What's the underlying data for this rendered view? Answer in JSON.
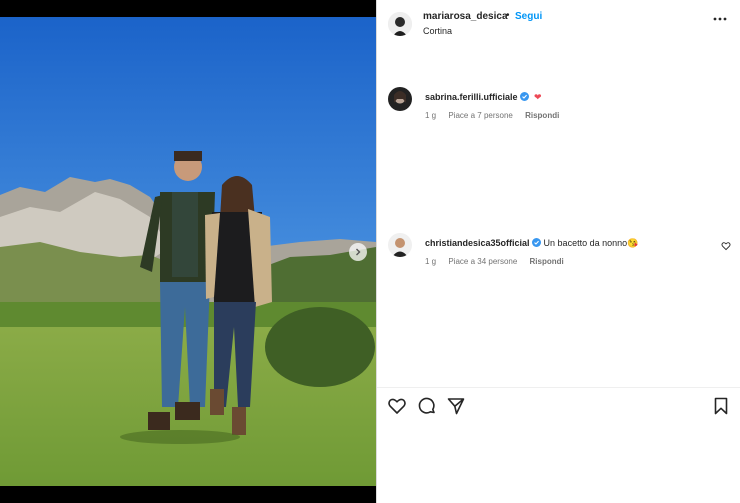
{
  "header": {
    "username": "mariarosa_desica",
    "separator": "•",
    "follow_label": "Segui",
    "location": "Cortina",
    "avatar_icon": "profile-avatar",
    "more_icon": "more-options-icon"
  },
  "comments": [
    {
      "username": "sabrina.ferilli.ufficiale",
      "verified": true,
      "text": "",
      "emoji": "❤",
      "time": "1 g",
      "likes": "Piace a 7 persone",
      "reply_label": "Rispondi"
    },
    {
      "username": "christiandesica35official",
      "verified": true,
      "text": "Un bacetto da nonno",
      "emoji": "😘",
      "time": "1 g",
      "likes": "Piace a 34 persone",
      "reply_label": "Rispondi"
    }
  ],
  "actions": {
    "like_icon": "heart-icon",
    "comment_icon": "comment-icon",
    "share_icon": "share-icon",
    "save_icon": "bookmark-icon"
  },
  "colors": {
    "follow": "#0095f6",
    "verified": "#3897f0",
    "heart_red": "#ed4956",
    "text": "#262626",
    "muted": "#737373"
  }
}
